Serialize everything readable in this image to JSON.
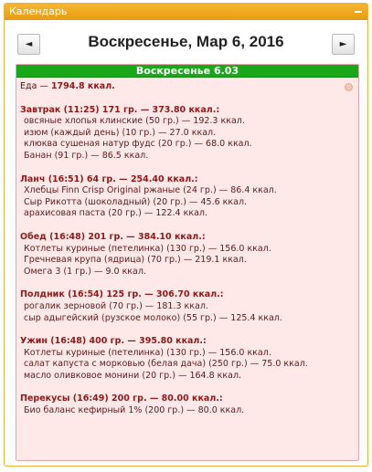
{
  "window": {
    "title": "Календарь"
  },
  "nav": {
    "prev_label": "◄",
    "next_label": "►",
    "date": "Воскресенье, Мар 6, 2016"
  },
  "day": {
    "header": "Воскресенье 6.03",
    "total_label": "Еда — ",
    "total_value": "1794.8 ккал.",
    "meals": [
      {
        "title": "Завтрак (11:25) 171 гр. — 373.80 ккал.:",
        "items": [
          "овсяные хлопья клинские (50 гр.) — 192.3 ккал.",
          "изюм (каждый день) (10 гр.) — 27.0 ккал.",
          "клюква сушеная натур фудс (20 гр.) — 68.0 ккал.",
          "Банан (91 гр.) — 86.5 ккал."
        ]
      },
      {
        "title": "Ланч (16:51) 64 гр. — 254.40 ккал.:",
        "items": [
          "Хлебцы Finn Crisp Original ржаные (24 гр.) — 86.4 ккал.",
          "Сыр Рикотта (шоколадный) (20 гр.) — 45.6 ккал.",
          "арахисовая паста (20 гр.) — 122.4 ккал."
        ]
      },
      {
        "title": "Обед (16:48) 201 гр. — 384.10 ккал.:",
        "items": [
          "Котлеты куриные (петелинка) (130 гр.) — 156.0 ккал.",
          "Гречневая крупа (ядрица) (70 гр.) — 219.1 ккал.",
          "Омега 3 (1 гр.) — 9.0 ккал."
        ]
      },
      {
        "title": "Полдник (16:54) 125 гр. — 306.70 ккал.:",
        "items": [
          "рогалик зерновой (70 гр.) — 181.3 ккал.",
          "сыр адыгейский (рузское молоко) (55 гр.) — 125.4 ккал."
        ]
      },
      {
        "title": "Ужин (16:48) 400 гр. — 395.80 ккал.:",
        "items": [
          "Котлеты куриные (петелинка) (130 гр.) — 156.0 ккал.",
          "салат капуста с морковью (белая дача) (250 гр.) — 75.0 ккал.",
          "масло оливковое монини (20 гр.) — 164.8 ккал."
        ]
      },
      {
        "title": "Перекусы (16:49) 200 гр. — 80.00 ккал.:",
        "items": [
          "Био баланс кефирный 1% (200 гр.) — 80.0 ккал."
        ]
      }
    ]
  }
}
